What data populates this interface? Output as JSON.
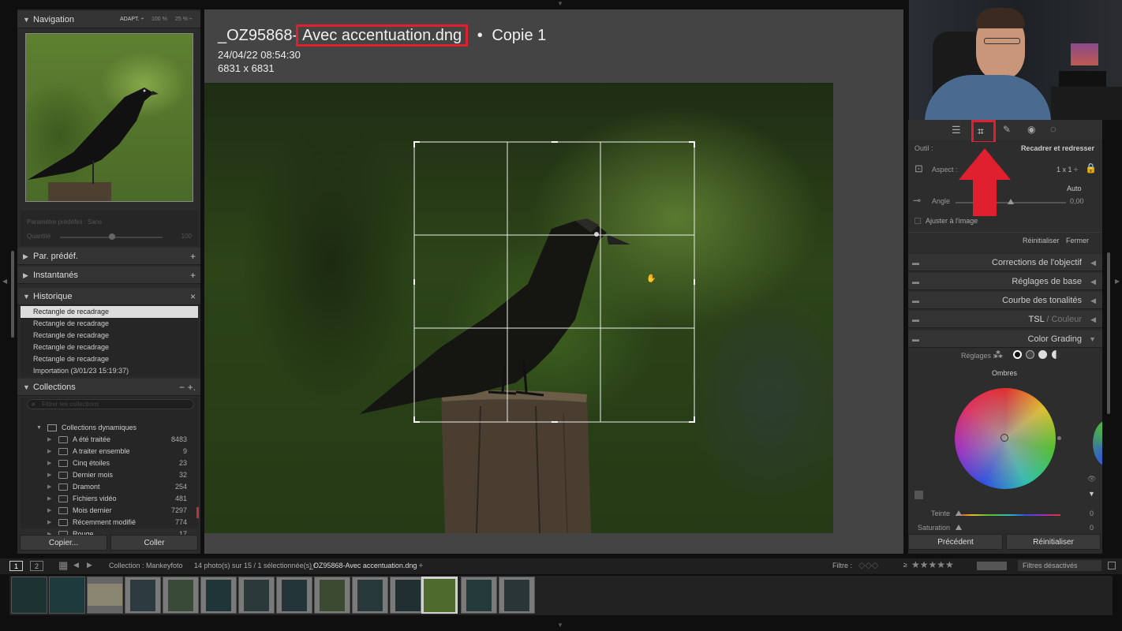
{
  "nav": {
    "title": "Navigation",
    "modes": [
      "ADAPT. ÷",
      "100 %",
      "25 % ÷"
    ]
  },
  "preset": {
    "label": "Paramètre prédéfini : Sans",
    "qty_label": "Quantité",
    "qty_value": "100"
  },
  "left_sections": {
    "presets": "Par. prédéf.",
    "snapshots": "Instantanés",
    "history": "Historique",
    "collections": "Collections"
  },
  "history": [
    "Rectangle de recadrage",
    "Rectangle de recadrage",
    "Rectangle de recadrage",
    "Rectangle de recadrage",
    "Rectangle de recadrage",
    "Importation (3/01/23 15:19:37)"
  ],
  "collections": {
    "search_placeholder": "Filtrer les collections",
    "group": "Collections dynamiques",
    "items": [
      {
        "name": "A été traitée",
        "count": "8483"
      },
      {
        "name": "A traiter ensemble",
        "count": "9"
      },
      {
        "name": "Cinq étoiles",
        "count": "23"
      },
      {
        "name": "Dernier mois",
        "count": "32"
      },
      {
        "name": "Dramont",
        "count": "254"
      },
      {
        "name": "Fichiers vidéo",
        "count": "481"
      },
      {
        "name": "Mois dernier",
        "count": "7297"
      },
      {
        "name": "Récemment modifié",
        "count": "774"
      },
      {
        "name": "Rouge",
        "count": "17"
      }
    ]
  },
  "left_buttons": {
    "copy": "Copier...",
    "paste": "Coller"
  },
  "photo": {
    "name_prefix": "_OZ95868-",
    "name_highlight": "Avec accentuation.dng",
    "copy": "Copie 1",
    "separator": "•",
    "date": "24/04/22 08:54:30",
    "size": "6831 x 6831"
  },
  "crop_tool": {
    "tool_label": "Outil :",
    "tool_name": "Recadrer et redresser",
    "aspect_label": "Aspect :",
    "aspect_value": "1 x 1 ÷",
    "auto": "Auto",
    "angle_label": "Angle",
    "angle_value": "0,00",
    "fit_label": "Ajuster à l'image",
    "reset": "Réinitialiser",
    "close": "Fermer"
  },
  "right_sections": [
    "Corrections de l'objectif",
    "Réglages de base",
    "Courbe des tonalités"
  ],
  "tsl": {
    "a": "TSL",
    "b": "Couleur"
  },
  "color_grading": {
    "title": "Color Grading",
    "settings": "Réglages :",
    "wheel": "Ombres",
    "tint": "Teinte",
    "tint_value": "0",
    "saturation": "Saturation",
    "saturation_value": "0"
  },
  "right_buttons": {
    "previous": "Précédent",
    "reset": "Réinitialiser"
  },
  "filmstrip": {
    "pages": [
      "1",
      "2"
    ],
    "collection": "Collection : Mankeyfoto",
    "count": "14 photo(s) sur 15 / 1 sélectionnée(s) /",
    "file": "_OZ95868-Avec accentuation.dng ÷",
    "filter_label": "Filtre :",
    "filter_value": "Filtres désactivés",
    "gte": "≥"
  },
  "colors": {
    "highlight": "#e0202e",
    "accent": "#e0202e"
  }
}
